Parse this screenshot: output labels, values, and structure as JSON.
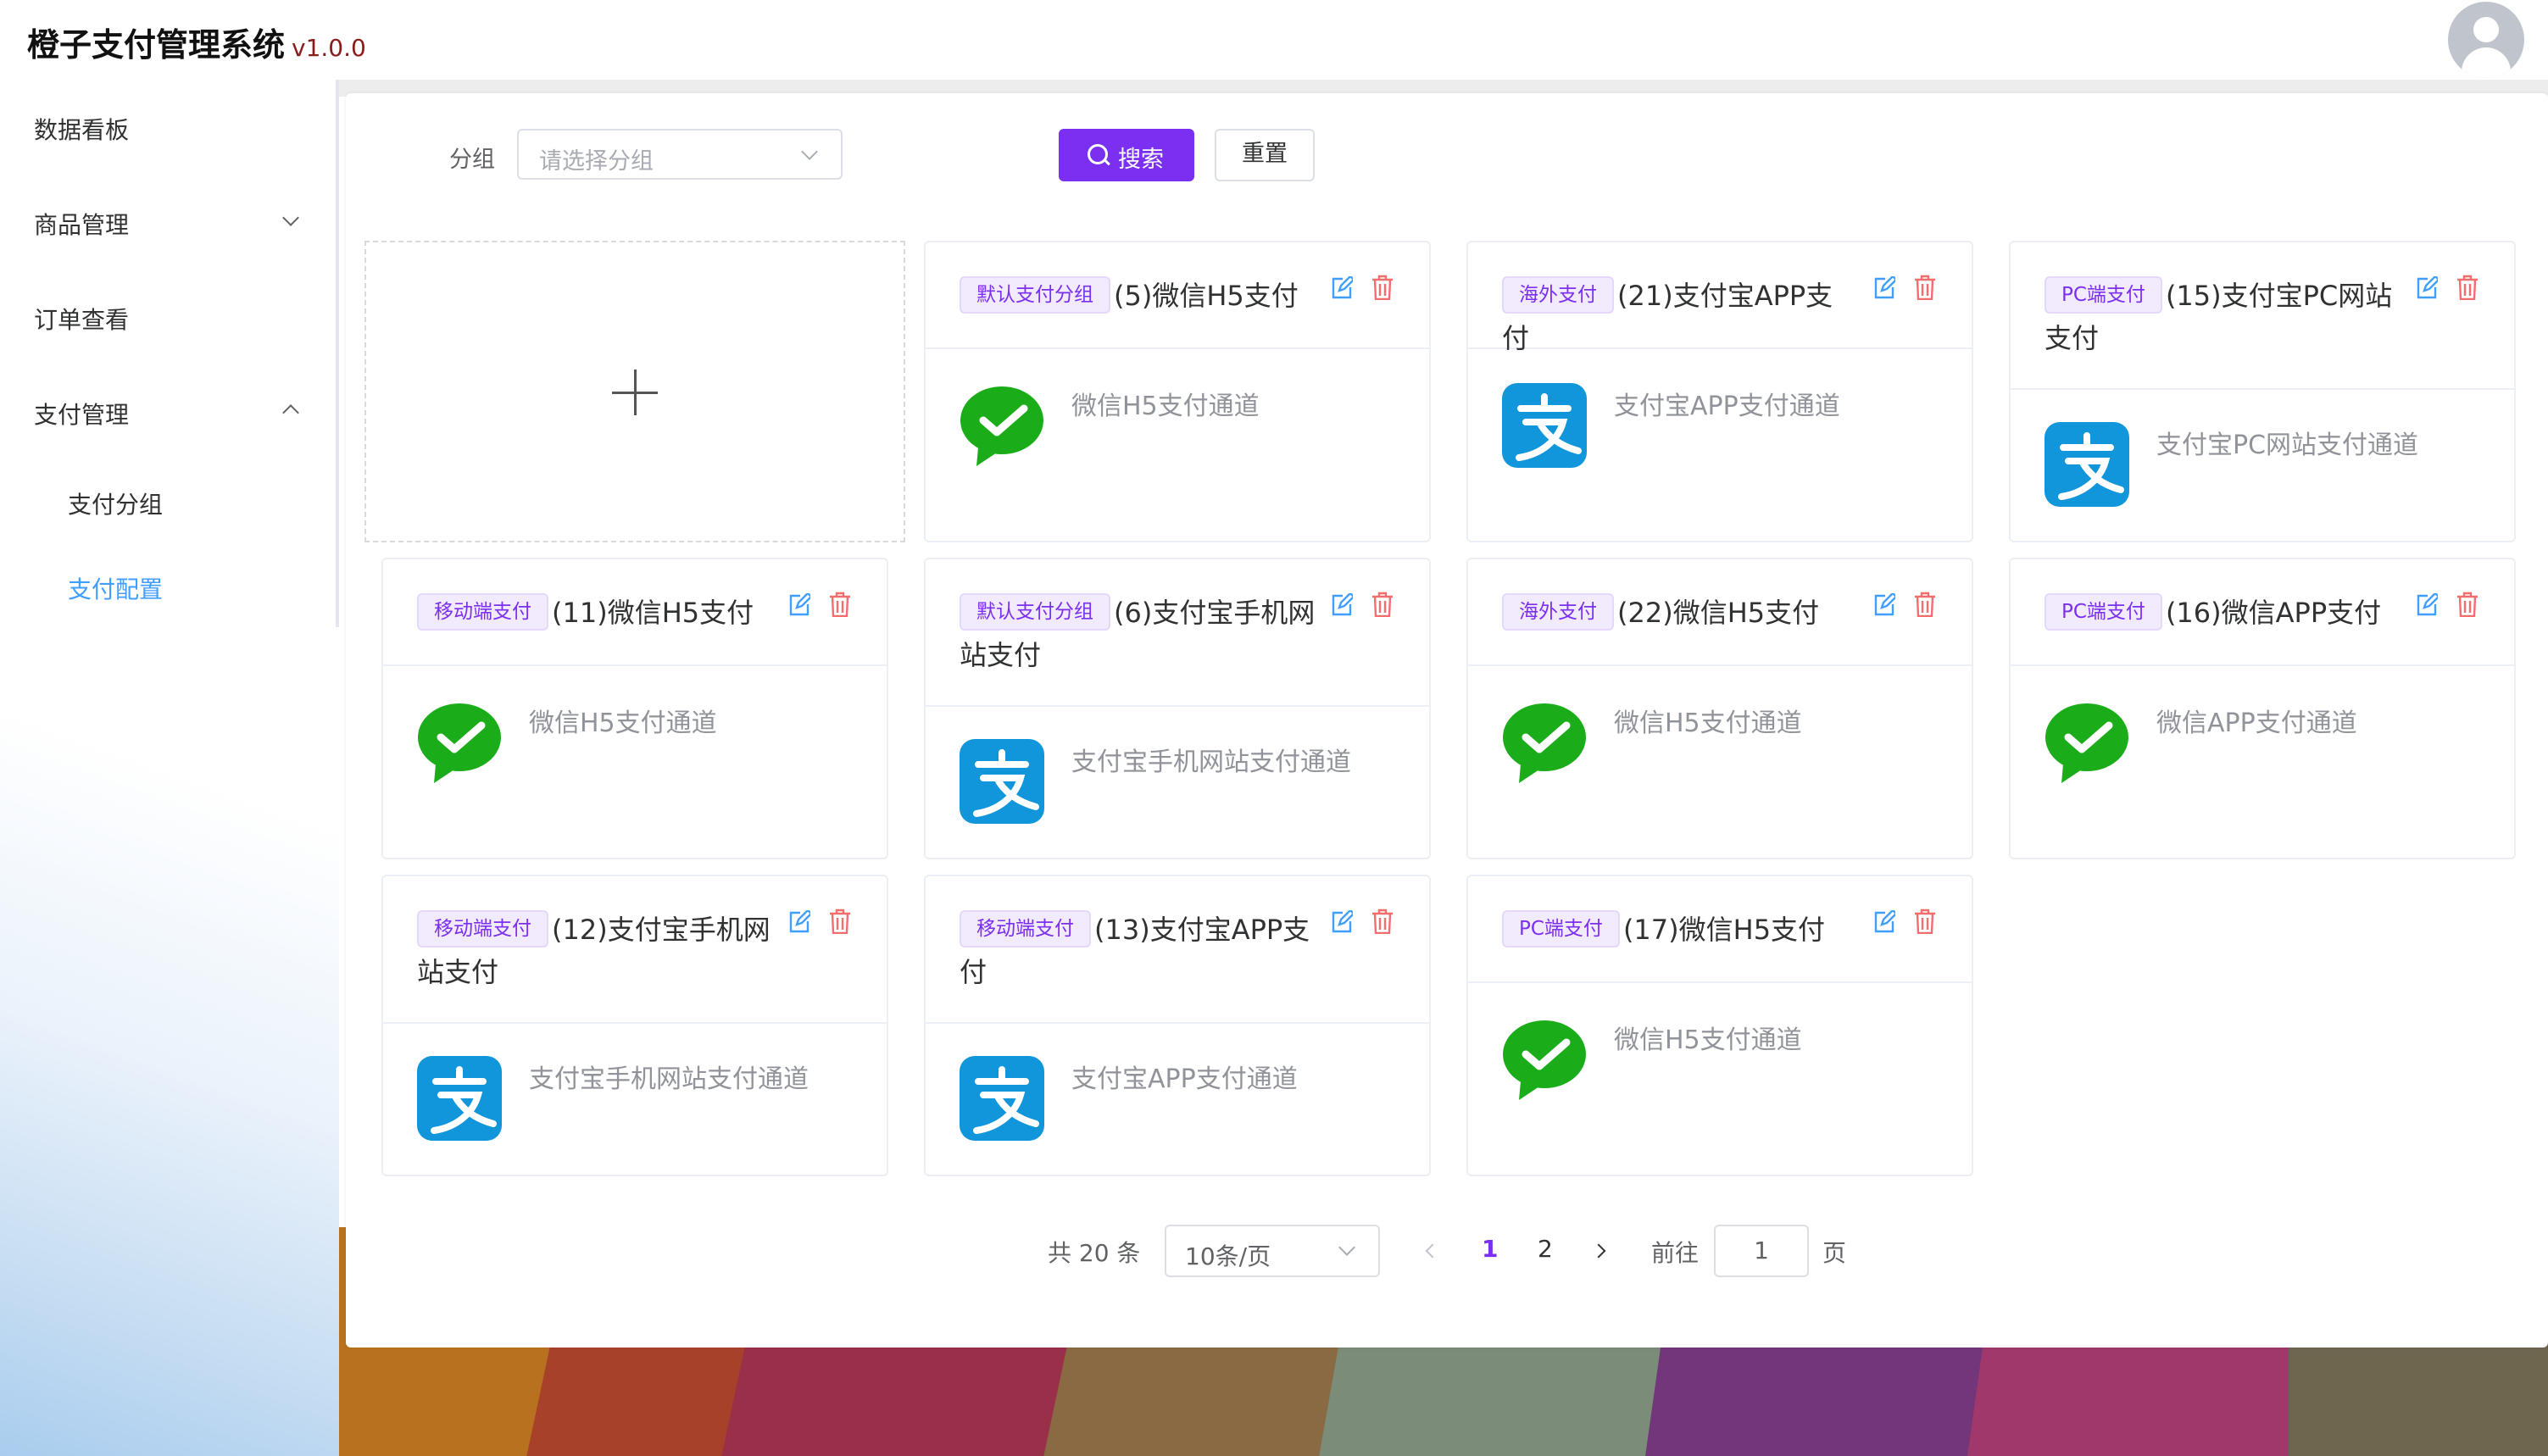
{
  "app": {
    "title": "橙子支付管理系统",
    "version": "v1.0.0"
  },
  "sidebar": {
    "items": [
      {
        "label": "数据看板"
      },
      {
        "label": "商品管理"
      },
      {
        "label": "订单查看"
      },
      {
        "label": "支付管理"
      }
    ],
    "subitems": [
      {
        "label": "支付分组"
      },
      {
        "label": "支付配置",
        "active": true
      }
    ]
  },
  "filter": {
    "group_label": "分组",
    "group_placeholder": "请选择分组",
    "search_label": "搜索",
    "reset_label": "重置"
  },
  "cards": [
    {
      "tag": "默认支付分组",
      "title": "(5)微信H5支付",
      "channel": "微信H5支付通道",
      "logo": "wechat-logo"
    },
    {
      "tag": "海外支付",
      "title": "(21)支付宝APP支付",
      "channel": "支付宝APP支付通道",
      "logo": "alipay-logo"
    },
    {
      "tag": "PC端支付",
      "title": "(15)支付宝PC网站支付",
      "channel": "支付宝PC网站支付通道",
      "logo": "alipay-logo"
    },
    {
      "tag": "移动端支付",
      "title": "(11)微信H5支付",
      "channel": "微信H5支付通道",
      "logo": "wechat-logo"
    },
    {
      "tag": "默认支付分组",
      "title": "(6)支付宝手机网站支付",
      "channel": "支付宝手机网站支付通道",
      "logo": "alipay-logo"
    },
    {
      "tag": "海外支付",
      "title": "(22)微信H5支付",
      "channel": "微信H5支付通道",
      "logo": "wechat-logo"
    },
    {
      "tag": "PC端支付",
      "title": "(16)微信APP支付",
      "channel": "微信APP支付通道",
      "logo": "wechat-logo"
    },
    {
      "tag": "移动端支付",
      "title": "(12)支付宝手机网站支付",
      "channel": "支付宝手机网站支付通道",
      "logo": "alipay-logo"
    },
    {
      "tag": "移动端支付",
      "title": "(13)支付宝APP支付",
      "channel": "支付宝APP支付通道",
      "logo": "alipay-logo"
    },
    {
      "tag": "PC端支付",
      "title": "(17)微信H5支付",
      "channel": "微信H5支付通道",
      "logo": "wechat-logo"
    }
  ],
  "pagination": {
    "total": "共 20 条",
    "page_size": "10条/页",
    "pages": [
      "1",
      "2"
    ],
    "current_page": "1",
    "goto_label": "前往",
    "goto_value": "1",
    "page_suffix": "页"
  },
  "colors": {
    "accent": "#7b2ff0",
    "active_menu": "#409eff",
    "delete": "#f56c6c",
    "wechat": "#1aad19",
    "alipay": "#1677ff"
  }
}
